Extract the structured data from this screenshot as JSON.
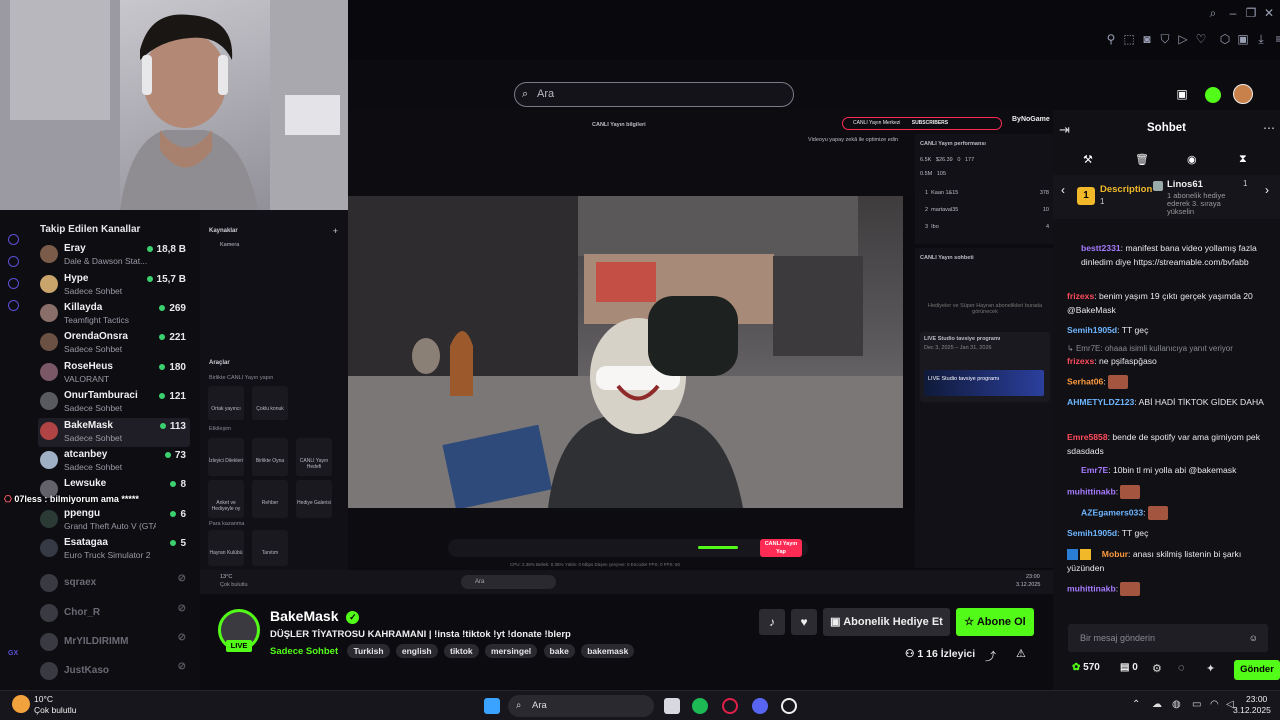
{
  "browser": {
    "search_placeholder": "Ara"
  },
  "studio": {
    "top": {
      "live_info": "CANLI Yayın bilgileri",
      "header_badge": "CANLI Yayın Merkezi",
      "subscribers": "SUBSCRIBERS",
      "brand": "ByNoGame",
      "optimize_hint": "Videoyu yapay zekâ ile optimize edin"
    },
    "sources_title": "Kaynaklar",
    "camera": "Kamera",
    "tools_title": "Araçlar",
    "together_title": "Birlikte CANLI Yayın yapın",
    "tools": [
      "Ortak yayıncı",
      "Çoklu konuk"
    ],
    "interaction_title": "Etkileşim",
    "interaction": [
      "İzleyici Dilekleri",
      "Birlikte Oyna",
      "CANLI Yayın Hedefi",
      "Anket ve Hediyeyle oy",
      "Rehber",
      "Hediye Galerisi"
    ],
    "earn_title": "Para kazanma",
    "earn": [
      "Hayran Kulübü",
      "Tanıtım"
    ],
    "perf": {
      "title": "CANLI Yayın performansı",
      "s1": "6.5K",
      "s2": "$26.39",
      "s3": "0",
      "s4": "177",
      "s5": "0.5M",
      "s6": "105",
      "rank": [
        {
          "n": "1",
          "name": "Kaan 1&15",
          "v": "378"
        },
        {
          "n": "2",
          "name": "martaval35",
          "v": "10"
        },
        {
          "n": "3",
          "name": "Ibo",
          "v": "4"
        }
      ]
    },
    "livechat_title": "CANLI Yayın sohbeti",
    "livechat_empty": "Hediyeler ve Süper Hayran abonelikleri burada görünecek",
    "promo_title": "LIVE Studio tavsiye programı",
    "promo_date": "Dec 3, 2025 – Jan 31, 2026",
    "promo_card": "LIVE Studio tavsiye programı",
    "go_live": "CANLI Yayın Yap",
    "stats": "CPU: 2.38%   Bellek: 0.35%   Yükle: 0 Mbps   Düşen çerçeve: 0   Encoder FPS: 0   FPS: 60",
    "inner_taskbar": {
      "weather": "13°C",
      "weather_desc": "Çok bulutlu",
      "search": "Ara",
      "time": "23:00",
      "date": "3.12.2025"
    }
  },
  "sidebar": {
    "title": "Takip Edilen Kanallar",
    "channels": [
      {
        "name": "Eray",
        "game": "Dale & Dawson Stat...",
        "viewers": "18,8 B",
        "color": "#7a5a48"
      },
      {
        "name": "Hype",
        "game": "Sadece Sohbet",
        "viewers": "15,7 B",
        "color": "#c9a46b"
      },
      {
        "name": "Killayda",
        "game": "Teamfight Tactics",
        "viewers": "269",
        "color": "#8a6e6a"
      },
      {
        "name": "OrendaOnsra",
        "game": "Sadece Sohbet",
        "viewers": "221",
        "color": "#6a5143"
      },
      {
        "name": "RoseHeus",
        "game": "VALORANT",
        "viewers": "180",
        "color": "#7a5866"
      },
      {
        "name": "OnurTamburaci",
        "game": "Sadece Sohbet",
        "viewers": "121",
        "color": "#595a5f"
      },
      {
        "name": "BakeMask",
        "game": "Sadece Sohbet",
        "viewers": "113",
        "color": "#b04343"
      },
      {
        "name": "atcanbey",
        "game": "Sadece Sohbet",
        "viewers": "73",
        "color": "#9fb0c4"
      },
      {
        "name": "Lewsuke",
        "game": "",
        "viewers": "8",
        "color": "#63626a"
      },
      {
        "name": "ppengu",
        "game": "Grand Theft Auto V (GTA)",
        "viewers": "6",
        "color": "#2c3a36"
      },
      {
        "name": "Esatagaa",
        "game": "Euro Truck Simulator 2",
        "viewers": "5",
        "color": "#353a44"
      }
    ],
    "offline": [
      "sqraex",
      "Chor_R",
      "MrYILDIRIMM",
      "JustKaso"
    ],
    "overlay_text": "07less : bilmiyorum ama *****",
    "gx": "GX"
  },
  "channel": {
    "name": "BakeMask",
    "live_badge": "LIVE",
    "title": "DÜŞLER TİYATROSU KAHRAMANI | !insta !tiktok !yt !donate !blerp",
    "category": "Sadece Sohbet",
    "tags": [
      "Turkish",
      "english",
      "tiktok",
      "mersingel",
      "bake",
      "bakemask"
    ],
    "gift_label": "Abonelik Hediye Et",
    "subscribe_label": "Abone Ol",
    "viewers_label": "İzleyici",
    "viewers_count": "1 16"
  },
  "chat": {
    "title": "Sohbet",
    "pinned": {
      "left_title": "Description",
      "left_sub": "1",
      "right_title": "Linos61",
      "right_count": "1",
      "right_text": "1 abonelik hediye ederek 3. sıraya yükselin"
    },
    "messages": [
      {
        "user": "bestt2331",
        "color": "#a77bff",
        "text": "manifest bana video yollamış fazla dinledim diye https://streamable.com/bvfabb"
      },
      {
        "user": "frizexs",
        "color": "#ff4b5c",
        "text": "benim yaşım 19 çıktı gerçek yaşımda 20 @BakeMask"
      },
      {
        "user": "Semih1905d",
        "color": "#6fb6ff",
        "text": "TT geç"
      },
      {
        "user": "Emr7E",
        "color": "#8a8a95",
        "text": "ohaaa isimli kullanıcıya yanıt veriyor",
        "reply": true
      },
      {
        "user": "frizexs",
        "color": "#ff4b5c",
        "text": "ne pşifaspğaso"
      },
      {
        "user": "Serhat06",
        "color": "#ff9a3c",
        "text": "",
        "emote": true
      },
      {
        "user": "AHMETYLDZ123",
        "color": "#6fb6ff",
        "text": "ABİ HADİ TİKTOK GİDEK DAHA"
      },
      {
        "user": "Emre5858",
        "color": "#ff4b5c",
        "text": "bende de spotify var ama girniyom pek sdasdads"
      },
      {
        "user": "Emr7E",
        "color": "#a77bff",
        "text": "10bin tl mi yolla abi @bakemask"
      },
      {
        "user": "muhittinakb",
        "color": "#a77bff",
        "text": "",
        "emote": true
      },
      {
        "user": "AZEgamers033",
        "color": "#6fb6ff",
        "text": "",
        "emote": true
      },
      {
        "user": "Semih1905d",
        "color": "#6fb6ff",
        "text": "TT geç"
      },
      {
        "user": "Mobur",
        "color": "#ff9a3c",
        "text": "anası skilmiş listenin bi şarkı yüzünden"
      },
      {
        "user": "muhittinakb",
        "color": "#a77bff",
        "text": "",
        "emote": true
      }
    ],
    "input_placeholder": "Bir mesaj gönderin",
    "points": "570",
    "points2": "0",
    "send_label": "Gönder"
  },
  "taskbar": {
    "weather_temp": "10°C",
    "weather_desc": "Çok bulutlu",
    "search": "Ara",
    "time": "23:00",
    "date": "3.12.2025"
  },
  "colors": {
    "accent": "#53fc18",
    "live_red": "#e0204b",
    "studio_pink": "#fe2c55"
  }
}
